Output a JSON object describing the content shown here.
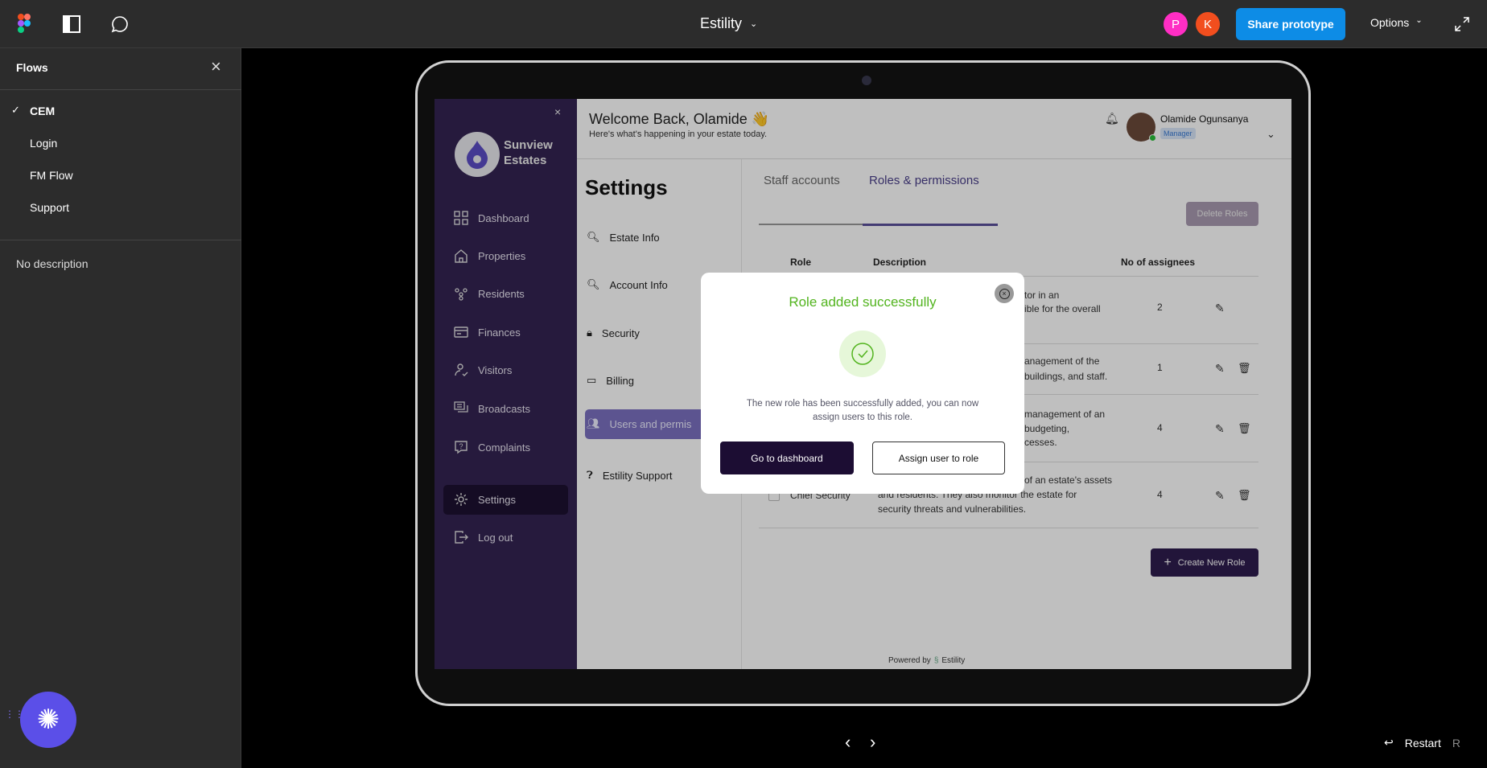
{
  "topbar": {
    "title": "Estility",
    "avatars": [
      {
        "letter": "P",
        "color": "#ff2ec4"
      },
      {
        "letter": "K",
        "color": "#f24e1e"
      }
    ],
    "share_label": "Share prototype",
    "options_label": "Options"
  },
  "flows": {
    "heading": "Flows",
    "items": [
      {
        "label": "CEM",
        "checked": true
      },
      {
        "label": "Login"
      },
      {
        "label": "FM Flow"
      },
      {
        "label": "Support"
      }
    ],
    "description": "No description"
  },
  "bottom": {
    "restart_label": "Restart",
    "restart_shortcut": "R"
  },
  "app": {
    "brand": "Sunview Estates",
    "brand_line1": "Sunview",
    "brand_line2": "Estates",
    "nav": [
      "Dashboard",
      "Properties",
      "Residents",
      "Finances",
      "Visitors",
      "Broadcasts",
      "Complaints"
    ],
    "settings_label": "Settings",
    "logout_label": "Log out",
    "welcome": "Welcome Back, Olamide 👋",
    "subtitle": "Here's what's happening in your estate today.",
    "user": {
      "name": "Olamide Ogunsanya",
      "role": "Manager"
    },
    "settings_title": "Settings",
    "settings_items": [
      "Estate Info",
      "Account Info",
      "Security",
      "Billing",
      "Users and permis",
      "Estility Support"
    ],
    "tabs": [
      "Staff accounts",
      "Roles & permissions"
    ],
    "delete_roles": "Delete Roles",
    "table": {
      "headers": [
        "Role",
        "Description",
        "No of assignees"
      ],
      "rows": [
        {
          "desc": [
            "tor in an",
            "ible for the overall"
          ],
          "count": "2"
        },
        {
          "desc": [
            "anagement of the",
            "buildings, and staff."
          ],
          "count": "1"
        },
        {
          "desc": [
            "management of an",
            "budgeting,",
            "cesses."
          ],
          "count": "4"
        },
        {
          "role": "Chief Security",
          "desc": [
            "of an estate's assets",
            "and residents. They also monitor the estate for",
            "security threats and vulnerabilities."
          ],
          "count": "4"
        }
      ]
    },
    "create_role": "Create New Role",
    "powered_by": "Powered by",
    "powered_brand": "Estility"
  },
  "modal": {
    "title": "Role added successfully",
    "message_line1": "The new role has been successfully added, you can now",
    "message_line2": "assign users to this role.",
    "primary": "Go to dashboard",
    "secondary": "Assign user to role",
    "accent": "#52b41e"
  }
}
